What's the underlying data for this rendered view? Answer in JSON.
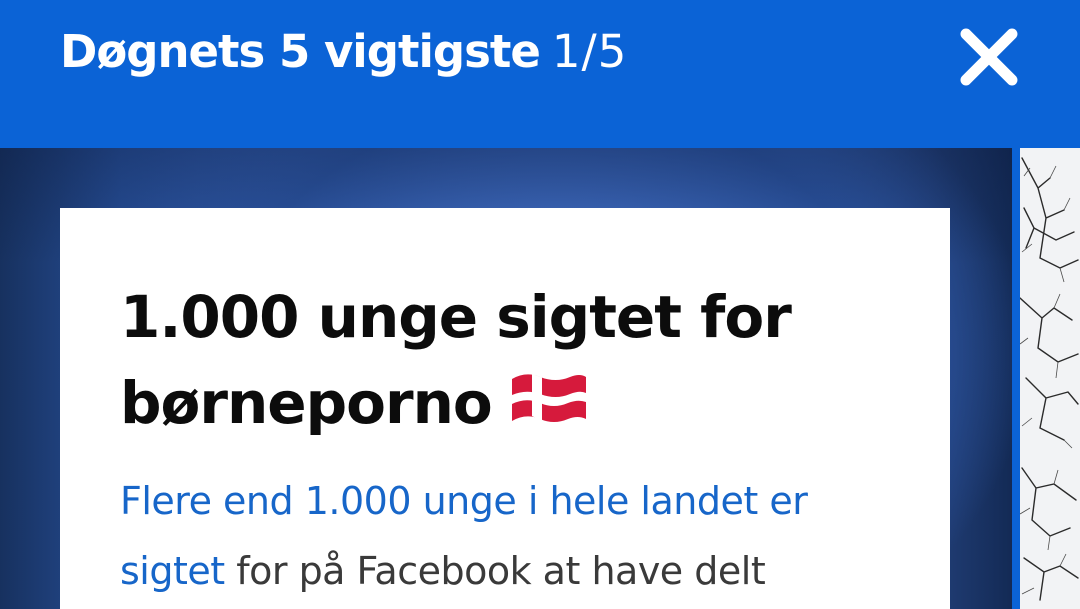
{
  "header": {
    "title": "Døgnets 5 vigtigste",
    "counter": "1/5",
    "close_icon": "close-icon"
  },
  "card": {
    "headline": "1.000 unge sigtet for børneporno",
    "headline_icon": "danish-flag-icon",
    "teaser_link_line1": "Flere end 1.000 unge i hele landet er",
    "teaser_link_line2": "sigtet",
    "teaser_rest": " for på Facebook at have delt"
  },
  "colors": {
    "header_bg": "#0b63d6",
    "link": "#1766c9",
    "flag_red": "#d61a3c"
  }
}
